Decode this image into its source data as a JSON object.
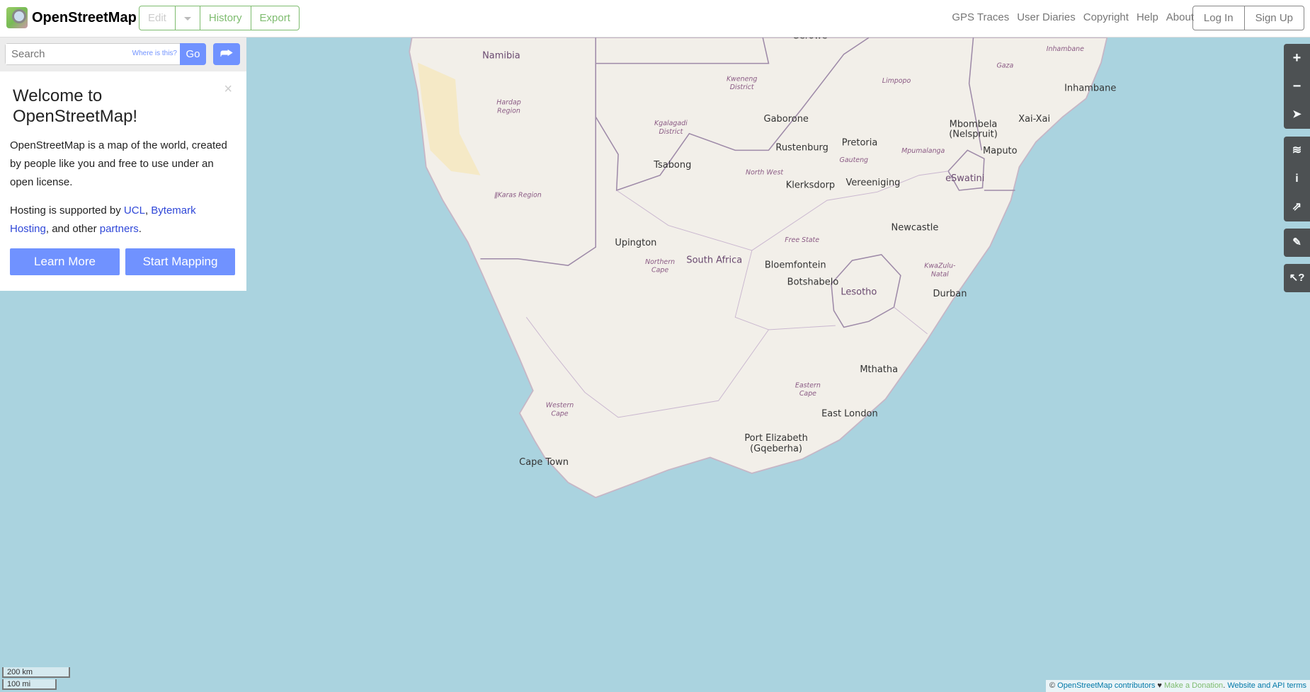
{
  "header": {
    "brand": "OpenStreetMap",
    "edit": "Edit",
    "history": "History",
    "export": "Export",
    "nav": [
      "GPS Traces",
      "User Diaries",
      "Copyright",
      "Help",
      "About"
    ],
    "login": "Log In",
    "signup": "Sign Up"
  },
  "search": {
    "placeholder": "Search",
    "where": "Where is this?",
    "go": "Go"
  },
  "welcome": {
    "title": "Welcome to OpenStreetMap!",
    "p1": "OpenStreetMap is a map of the world, created by people like you and free to use under an open license.",
    "p2_pre": "Hosting is supported by ",
    "ucl": "UCL",
    "sep": ", ",
    "bytemark": "Bytemark Hosting",
    "p2_mid": ", and other ",
    "partners": "partners",
    "p2_end": ".",
    "learn": "Learn More",
    "start": "Start Mapping",
    "close": "×"
  },
  "controls": [
    "zoom-in",
    "zoom-out",
    "locate",
    "layers",
    "map-data",
    "share",
    "add-note",
    "query-features"
  ],
  "scale": {
    "km": "200 km",
    "mi": "100 mi"
  },
  "attribution": {
    "copy": "© ",
    "osm": "OpenStreetMap contributors",
    "heart": " ♥ ",
    "donate": "Make a Donation",
    "dot": ". ",
    "terms": "Website and API terms"
  },
  "map": {
    "countries": [
      [
        "Namibia",
        600,
        70
      ],
      [
        "South Africa",
        855,
        315
      ],
      [
        "Lesotho",
        1028,
        353
      ],
      [
        "eSwatini",
        1155,
        217
      ]
    ],
    "cities": [
      [
        "Gaborone",
        941,
        146
      ],
      [
        "Pretoria",
        1029,
        174
      ],
      [
        "Rustenburg",
        960,
        180
      ],
      [
        "Maputo",
        1197,
        184
      ],
      [
        "Bloemfontein",
        952,
        321
      ],
      [
        "Durban",
        1137,
        355
      ],
      [
        "Cape Town",
        651,
        557
      ],
      [
        "Port Elizabeth",
        929,
        528
      ],
      [
        "(Gqeberha)",
        929,
        541
      ],
      [
        "East London",
        1017,
        499
      ],
      [
        "Upington",
        761,
        294
      ],
      [
        "Tsabong",
        805,
        201
      ],
      [
        "Klerksdorp",
        970,
        225
      ],
      [
        "Vereeniging",
        1045,
        222
      ],
      [
        "Newcastle",
        1095,
        276
      ],
      [
        "Botshabelo",
        973,
        341
      ],
      [
        "Mthatha",
        1052,
        446
      ],
      [
        "Mbombela",
        1165,
        152
      ],
      [
        "(Nelspruit)",
        1165,
        164
      ],
      [
        "Inhambane",
        1305,
        109
      ],
      [
        "Xai-Xai",
        1238,
        146
      ],
      [
        "Serowe",
        970,
        46
      ]
    ],
    "regions": [
      [
        "Hardap",
        609,
        125
      ],
      [
        "Region",
        609,
        135
      ],
      [
        "Kgalagadi",
        803,
        150
      ],
      [
        "District",
        803,
        160
      ],
      [
        "Kweneng",
        888,
        97
      ],
      [
        "District",
        888,
        107
      ],
      [
        "ǁKaras Region",
        620,
        236
      ],
      [
        "North West",
        915,
        209
      ],
      [
        "Gauteng",
        1022,
        194
      ],
      [
        "Mpumalanga",
        1105,
        183
      ],
      [
        "Limpopo",
        1073,
        99
      ],
      [
        "Northern",
        790,
        316
      ],
      [
        "Cape",
        790,
        326
      ],
      [
        "Free State",
        960,
        290
      ],
      [
        "KwaZulu-",
        1125,
        321
      ],
      [
        "Natal",
        1125,
        331
      ],
      [
        "Eastern",
        967,
        464
      ],
      [
        "Cape",
        967,
        474
      ],
      [
        "Western",
        670,
        488
      ],
      [
        "Cape",
        670,
        498
      ],
      [
        "Gaza",
        1203,
        81
      ],
      [
        "Inhambane",
        1275,
        61
      ]
    ]
  }
}
